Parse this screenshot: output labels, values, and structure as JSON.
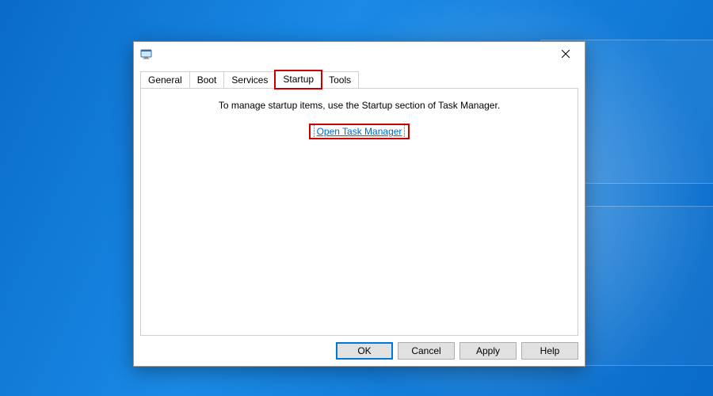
{
  "window": {
    "title": ""
  },
  "tabs": {
    "general": "General",
    "boot": "Boot",
    "services": "Services",
    "startup": "Startup",
    "tools": "Tools"
  },
  "startup_page": {
    "info_text": "To manage startup items, use the Startup section of Task Manager.",
    "link_text": "Open Task Manager"
  },
  "buttons": {
    "ok": "OK",
    "cancel": "Cancel",
    "apply": "Apply",
    "help": "Help"
  }
}
